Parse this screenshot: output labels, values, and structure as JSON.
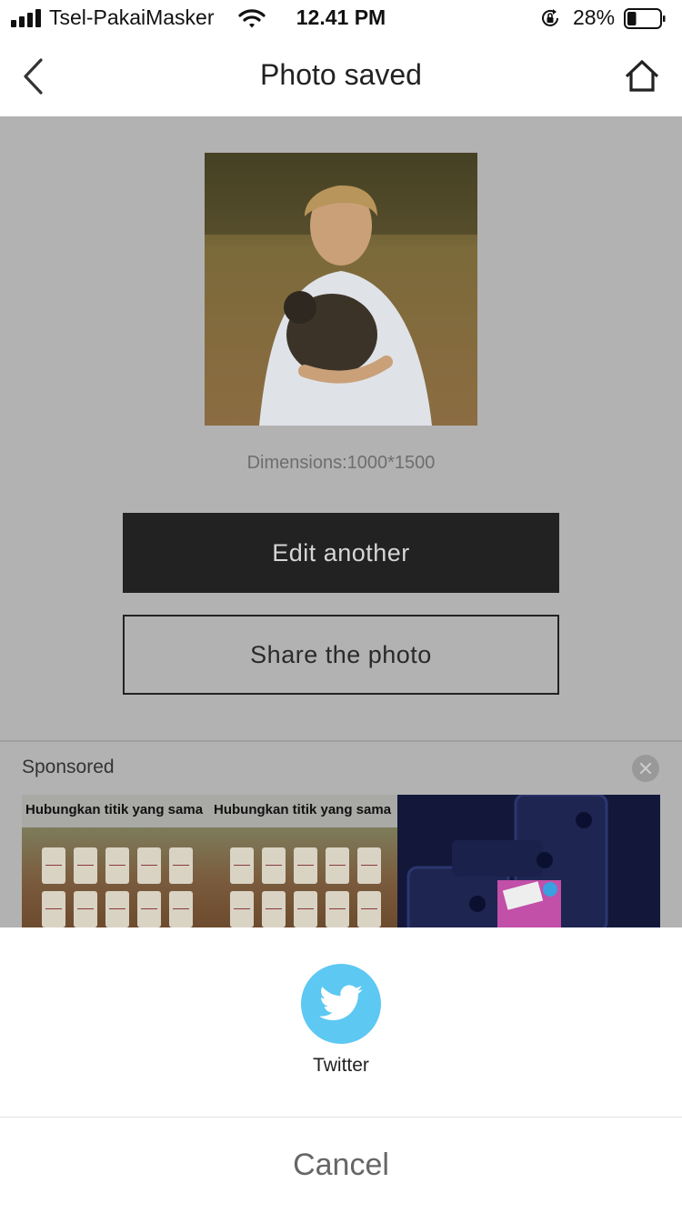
{
  "status_bar": {
    "carrier": "Tsel-PakaiMasker",
    "time": "12.41 PM",
    "battery_percent": "28%",
    "battery_level": 0.28
  },
  "nav": {
    "title": "Photo saved",
    "back_icon": "chevron-left-icon",
    "home_icon": "home-icon"
  },
  "main": {
    "dimensions_label": "Dimensions:1000*1500",
    "edit_button": "Edit another",
    "share_button": "Share the photo"
  },
  "ad": {
    "sponsored_label": "Sponsored",
    "caption_1": "Hubungkan titik yang sama",
    "caption_2": "Hubungkan titik yang sama"
  },
  "share_sheet": {
    "items": [
      {
        "label": "Twitter",
        "icon": "twitter-icon",
        "color": "#5dc8f2"
      }
    ],
    "cancel_label": "Cancel"
  }
}
